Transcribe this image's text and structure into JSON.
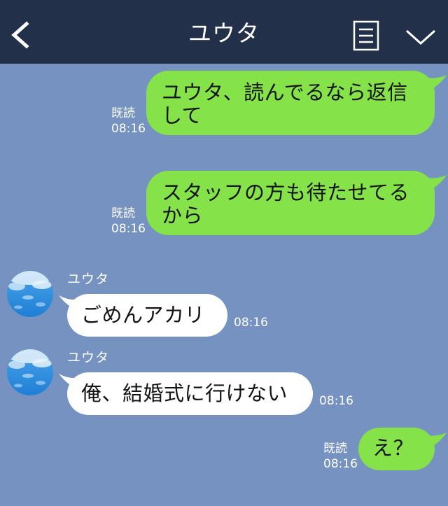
{
  "header": {
    "title": "ユウタ",
    "back_icon": "chevron-left-icon",
    "menu_icon": "list-menu-icon",
    "collapse_icon": "chevron-down-icon"
  },
  "messages": [
    {
      "direction": "out",
      "text_line1": "ユウタ、読んでるなら返信",
      "text_line2": "して",
      "read": "既読",
      "time": "08:16"
    },
    {
      "direction": "out",
      "text_line1": "スタッフの方も待たせてる",
      "text_line2": "から",
      "read": "既読",
      "time": "08:16"
    },
    {
      "direction": "in",
      "sender": "ユウタ",
      "text": "ごめんアカリ",
      "time": "08:16"
    },
    {
      "direction": "in",
      "sender": "ユウタ",
      "text": "俺、結婚式に行けない",
      "time": "08:16"
    },
    {
      "direction": "out",
      "text": "え？",
      "read": "既読",
      "time": "08:16"
    }
  ],
  "colors": {
    "header_bg": "#23304a",
    "chat_bg": "#7592c0",
    "outgoing_bubble": "#85e249",
    "incoming_bubble": "#ffffff"
  }
}
